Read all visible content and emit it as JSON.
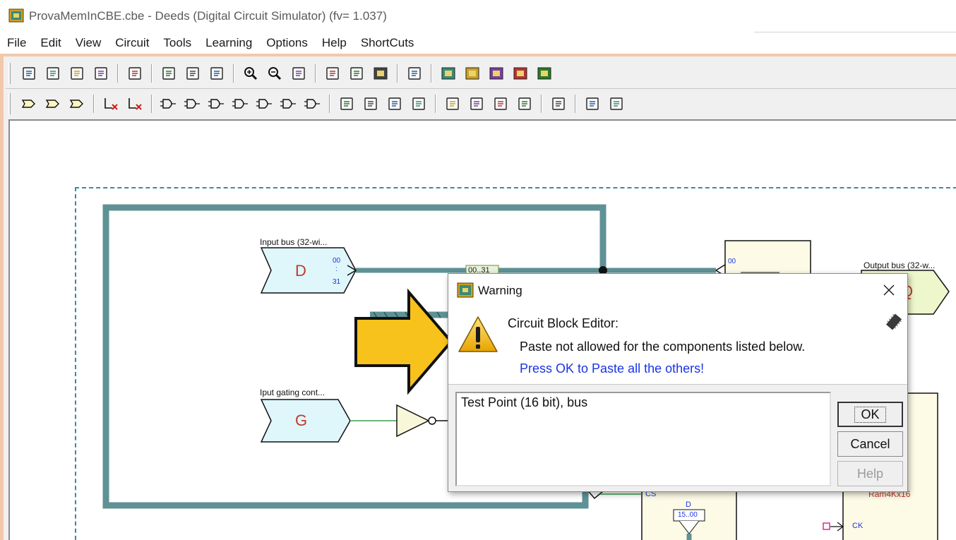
{
  "window": {
    "title": "ProvaMemInCBE.cbe - Deeds (Digital Circuit Simulator) (fv= 1.037)"
  },
  "menu": [
    "File",
    "Edit",
    "View",
    "Circuit",
    "Tools",
    "Learning",
    "Options",
    "Help",
    "ShortCuts"
  ],
  "toolbar1": {
    "groups": [
      [
        "new-file-icon",
        "open-folder-icon",
        "save-icon",
        "print-icon"
      ],
      [
        "undo-icon"
      ],
      [
        "cut-icon",
        "copy-icon",
        "paste-icon"
      ],
      [
        "zoom-in-icon",
        "zoom-out-icon",
        "pan-hand-icon"
      ],
      [
        "select-arrow-icon",
        "eraser-icon",
        "component-chip-icon"
      ],
      [
        "wire-tool-icon"
      ],
      [
        "component-a-icon",
        "component-b-icon",
        "component-c-icon",
        "component-d-icon",
        "component-e-icon"
      ]
    ]
  },
  "toolbar2": {
    "groups": [
      [
        "input-port-icon",
        "output-port-icon",
        "bidir-port-icon"
      ],
      [
        "wire-delete-icon",
        "node-delete-icon"
      ],
      [
        "buffer-gate-icon",
        "and-gate-icon",
        "nand-gate-icon",
        "or-gate-icon",
        "nor-gate-icon",
        "xor-gate-icon",
        "xnor-gate-icon"
      ],
      [
        "mux-icon",
        "demux-icon",
        "decoder-icon",
        "encoder-icon"
      ],
      [
        "flipflop-icon",
        "register-icon",
        "counter-icon",
        "memory-icon"
      ],
      [
        "block-icon"
      ],
      [
        "properties-icon",
        "panel-icon"
      ]
    ]
  },
  "circuit": {
    "input_bus_label": "Input bus (32-wi...",
    "input_bus_letter": "D",
    "input_bus_bits_top": "00",
    "input_bus_bits_mid": ":",
    "input_bus_bits_bot": "31",
    "bus_tap_label": "00..31",
    "gating_label": "Iput gating cont...",
    "gating_letter": "G",
    "output_bus_label": "Output bus (32-w...",
    "output_bus_letter": "Q",
    "block_pin_00": "00",
    "cs_label": "CS",
    "d_label": "D",
    "d_range": "15..00",
    "ram_label": "Ram4Kx16",
    "ck_label": "CK"
  },
  "dialog": {
    "title": "Warning",
    "heading": "Circuit Block Editor:",
    "message": "Paste not allowed for the components listed below.",
    "hint": "Press OK to Paste all the others!",
    "list_items": [
      "Test Point (16 bit), bus"
    ],
    "ok_label": "OK",
    "cancel_label": "Cancel",
    "help_label": "Help"
  },
  "colors": {
    "accent_frame": "#f2c8aa",
    "wire_bus": "#5f9295",
    "port_fill": "#dff6fb",
    "output_fill": "#eef6cc",
    "block_fill": "#fdfbe6",
    "arrow_fill": "#f7c21b",
    "hint_blue": "#1a34e6"
  }
}
